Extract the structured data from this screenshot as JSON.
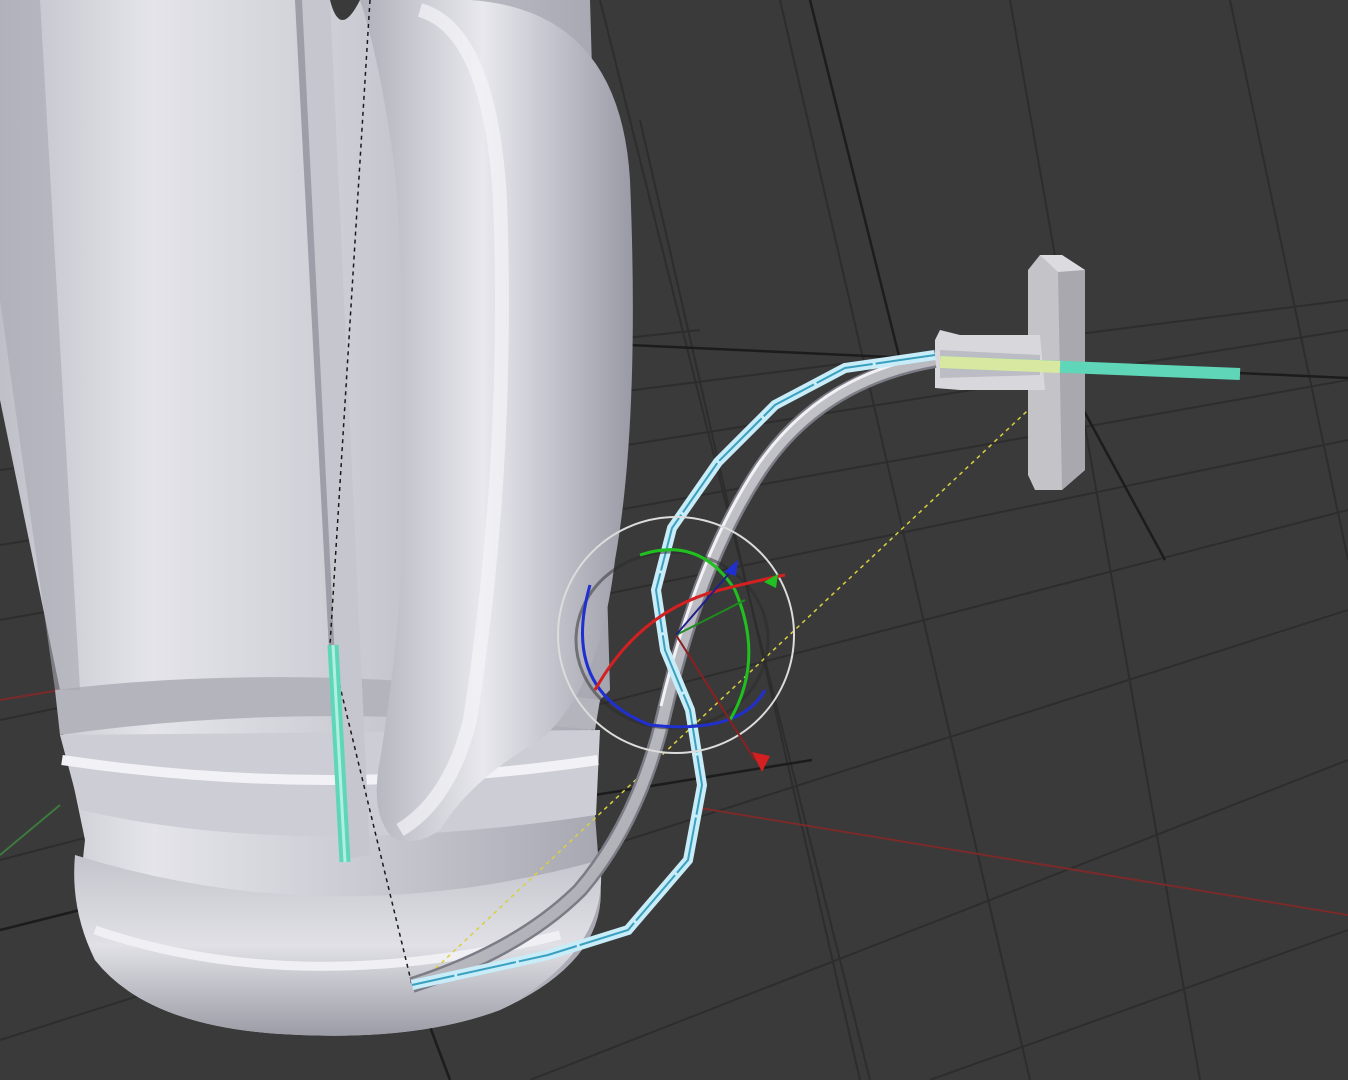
{
  "viewport": {
    "kind": "3d-viewport",
    "background": "#3a3a3a",
    "grid_color": "#2c2c2c",
    "axis_x_color": "#8a2a2a",
    "axis_y_color": "#3d7a3d"
  },
  "scene": {
    "objects": [
      {
        "name": "kettle-body",
        "material": "matte-white",
        "color": "#d2d2da"
      },
      {
        "name": "kettle-handle",
        "material": "matte-white",
        "color": "#cfcfd8"
      },
      {
        "name": "power-cord",
        "material": "metallic",
        "color": "#b8b8c0"
      },
      {
        "name": "wall-plug",
        "material": "matte-white",
        "color": "#c8c8cc"
      },
      {
        "name": "armature-bone-chain",
        "color": "#c8ecf8",
        "bone_count": 11
      },
      {
        "name": "selected-bone",
        "color": "#5fd6b8"
      }
    ],
    "gizmo": {
      "mode": "rotate",
      "x_axis_color": "#d42020",
      "y_axis_color": "#20c020",
      "z_axis_color": "#2030d0",
      "trackball_color": "#dcdcdc"
    },
    "relationship_line_color": "#d8d040"
  }
}
